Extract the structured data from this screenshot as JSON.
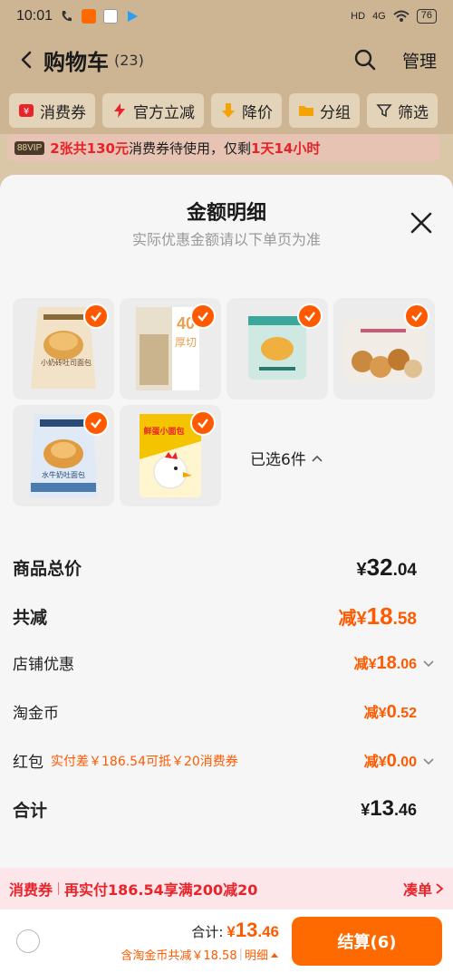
{
  "status_bar": {
    "time": "10:01",
    "network": "4G",
    "battery": "76"
  },
  "header": {
    "title": "购物车",
    "count": "(23)",
    "manage": "管理"
  },
  "filters": [
    {
      "label": "消费券",
      "icon": "coupon-icon"
    },
    {
      "label": "官方立减",
      "icon": "lightning-icon"
    },
    {
      "label": "降价",
      "icon": "price-drop-icon"
    },
    {
      "label": "分组",
      "icon": "folder-icon"
    },
    {
      "label": "筛选",
      "icon": "filter-icon"
    }
  ],
  "vip_bar": {
    "badge": "88VIP",
    "highlight": "2张共130元",
    "text": "消费券待使用，仅剩",
    "time_left": "1天14小时"
  },
  "sheet": {
    "title": "金额明细",
    "subtitle": "实际优惠金额请以下单页为准",
    "products": [
      {
        "name": "小奶砖吐司面包"
      },
      {
        "name": "厚切吐司"
      },
      {
        "name": "黄油面包"
      },
      {
        "name": "奶酪小面包"
      },
      {
        "name": "水牛奶吐司"
      },
      {
        "name": "鲜蛋小面包"
      }
    ],
    "product_label_0": "小奶砖吐司面包",
    "product_label_1": "40",
    "product_label_1b": "厚切",
    "product_label_4": "水牛奶吐面包",
    "product_label_5": "鲜蛋小面包",
    "selected_text": "已选6件"
  },
  "breakdown": {
    "total_label": "商品总价",
    "total_value": {
      "yen": "¥",
      "int": "32",
      "dec": ".04"
    },
    "reduce_label": "共减",
    "reduce_value": {
      "prefix": "减¥",
      "int": "18",
      "dec": ".58"
    },
    "store_label": "店铺优惠",
    "store_value": {
      "prefix": "减¥",
      "int": "18",
      "dec": ".06"
    },
    "coin_label": "淘金币",
    "coin_value": {
      "prefix": "减¥",
      "int": "0",
      "dec": ".52"
    },
    "redpack_label": "红包",
    "redpack_hint": "实付差￥186.54可抵￥20消费券",
    "redpack_value": {
      "prefix": "减¥",
      "int": "0",
      "dec": ".00"
    },
    "sum_label": "合计",
    "sum_value": {
      "yen": "¥",
      "int": "13",
      "dec": ".46"
    }
  },
  "coupon_bar": {
    "tag": "消费券",
    "text": "再实付186.54享满200减20",
    "action": "凑单"
  },
  "footer": {
    "sum_label": "合计:",
    "sum_yen": "¥",
    "sum_int": "13",
    "sum_dec": ".46",
    "detail_text": "含淘金币共减￥18.58",
    "detail_link": "明细",
    "checkout": "结算(6)"
  },
  "colors": {
    "accent": "#ff5a00",
    "checkout": "#ff6a00",
    "red": "#e8232a"
  }
}
